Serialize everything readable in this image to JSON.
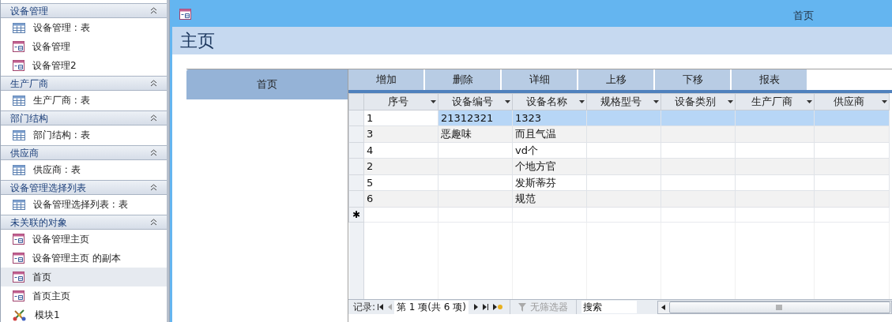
{
  "navigation_pane": {
    "groups": [
      {
        "title": "设备管理",
        "items": [
          {
            "kind": "table",
            "label": "设备管理 : 表",
            "selected": false
          },
          {
            "kind": "form",
            "label": "设备管理",
            "selected": false
          },
          {
            "kind": "form",
            "label": "设备管理2",
            "selected": false
          }
        ]
      },
      {
        "title": "生产厂商",
        "items": [
          {
            "kind": "table",
            "label": "生产厂商 : 表",
            "selected": false
          }
        ]
      },
      {
        "title": "部门结构",
        "items": [
          {
            "kind": "table",
            "label": "部门结构 : 表",
            "selected": false
          }
        ]
      },
      {
        "title": "供应商",
        "items": [
          {
            "kind": "table",
            "label": "供应商 : 表",
            "selected": false
          }
        ]
      },
      {
        "title": "设备管理选择列表",
        "items": [
          {
            "kind": "table",
            "label": "设备管理选择列表 : 表",
            "selected": false
          }
        ]
      },
      {
        "title": "未关联的对象",
        "items": [
          {
            "kind": "form",
            "label": "设备管理主页",
            "selected": false
          },
          {
            "kind": "form",
            "label": "设备管理主页 的副本",
            "selected": false
          },
          {
            "kind": "form",
            "label": "首页",
            "selected": true
          },
          {
            "kind": "form",
            "label": "首页主页",
            "selected": false
          },
          {
            "kind": "module",
            "label": "模块1",
            "selected": false
          }
        ]
      }
    ]
  },
  "window": {
    "title": "首页"
  },
  "form": {
    "header": "主页",
    "nav_tabs": [
      {
        "label": "首页",
        "selected": true
      }
    ],
    "buttons": [
      "增加",
      "删除",
      "详细",
      "上移",
      "下移",
      "报表"
    ],
    "table": {
      "columns": [
        "序号",
        "设备编号",
        "设备名称",
        "规格型号",
        "设备类别",
        "生产厂商",
        "供应商"
      ],
      "rows": [
        {
          "cells": [
            "1",
            "21312321",
            "1323",
            "",
            "",
            "",
            ""
          ],
          "selected": true
        },
        {
          "cells": [
            "3",
            "恶趣味",
            "而且气温",
            "",
            "",
            "",
            ""
          ],
          "selected": false
        },
        {
          "cells": [
            "4",
            "",
            "vd个",
            "",
            "",
            "",
            ""
          ],
          "selected": false
        },
        {
          "cells": [
            "2",
            "",
            "个地方官",
            "",
            "",
            "",
            ""
          ],
          "selected": false
        },
        {
          "cells": [
            "5",
            "",
            "发斯蒂芬",
            "",
            "",
            "",
            ""
          ],
          "selected": false
        },
        {
          "cells": [
            "6",
            "",
            "规范",
            "",
            "",
            "",
            ""
          ],
          "selected": false
        }
      ],
      "new_row_marker": "✱"
    },
    "record_navigator": {
      "label": "记录:",
      "position": "第 1 项(共 6 项)",
      "filter": {
        "label": "无筛选器",
        "disabled": true
      },
      "search": {
        "placeholder": "搜索"
      }
    }
  }
}
